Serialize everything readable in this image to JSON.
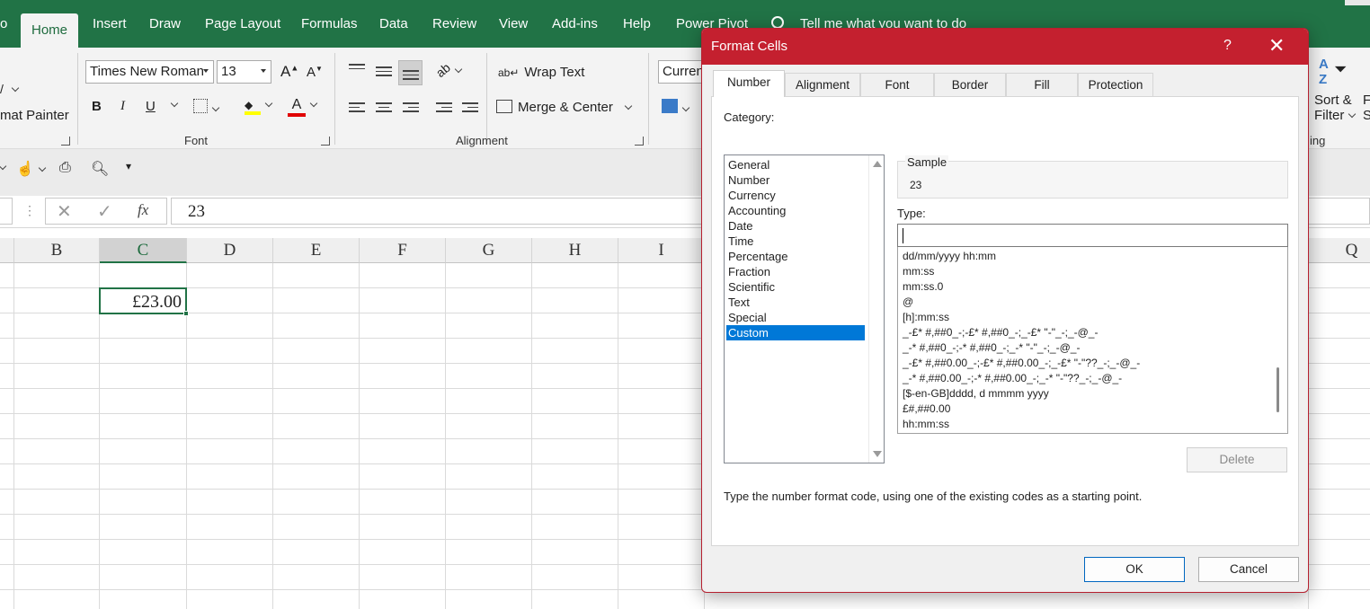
{
  "ribbon": {
    "tabs": [
      "o",
      "Home",
      "Insert",
      "Draw",
      "Page Layout",
      "Formulas",
      "Data",
      "Review",
      "View",
      "Add-ins",
      "Help",
      "Power Pivot"
    ],
    "active_tab": "Home",
    "tell_me": "Tell me what you want to do",
    "clipboard": {
      "format_painter": "mat Painter"
    },
    "font": {
      "family": "Times New Roman",
      "size": "13",
      "group_label": "Font",
      "bold": "B",
      "italic": "I",
      "underline": "U",
      "grow": "A",
      "shrink": "A"
    },
    "alignment": {
      "wrap_text": "Wrap Text",
      "merge_center": "Merge & Center",
      "group_label": "Alignment"
    },
    "number": {
      "format_box": "Currenc"
    },
    "editing": {
      "sort_filter_line1": "Sort &",
      "sort_filter_line2": "Filter",
      "find_select_line1": "F",
      "find_select_line2": "Se",
      "group_label_partial": "ing"
    }
  },
  "formula_bar": {
    "fx_label": "fx",
    "value": "23"
  },
  "grid": {
    "columns": [
      "B",
      "C",
      "D",
      "E",
      "F",
      "G",
      "H",
      "I",
      "Q"
    ],
    "selected_column": "C",
    "active_cell_value": "£23.00"
  },
  "dialog": {
    "title": "Format Cells",
    "help": "?",
    "close": "✕",
    "tabs": [
      "Number",
      "Alignment",
      "Font",
      "Border",
      "Fill",
      "Protection"
    ],
    "active_tab": "Number",
    "category_label": "Category:",
    "categories": [
      "General",
      "Number",
      "Currency",
      "Accounting",
      "Date",
      "Time",
      "Percentage",
      "Fraction",
      "Scientific",
      "Text",
      "Special",
      "Custom"
    ],
    "selected_category": "Custom",
    "sample_label": "Sample",
    "sample_value": "23",
    "type_label": "Type:",
    "type_value": "",
    "type_list": [
      "dd/mm/yyyy hh:mm",
      "mm:ss",
      "mm:ss.0",
      "@",
      "[h]:mm:ss",
      "_-£* #,##0_-;-£* #,##0_-;_-£* \"-\"_-;_-@_-",
      "_-* #,##0_-;-* #,##0_-;_-* \"-\"_-;_-@_-",
      "_-£* #,##0.00_-;-£* #,##0.00_-;_-£* \"-\"??_-;_-@_-",
      "_-* #,##0.00_-;-* #,##0.00_-;_-* \"-\"??_-;_-@_-",
      "[$-en-GB]dddd, d mmmm yyyy",
      "£#,##0.00",
      "hh:mm:ss"
    ],
    "delete_label": "Delete",
    "hint": "Type the number format code, using one of the existing codes as a starting point.",
    "ok_label": "OK",
    "cancel_label": "Cancel"
  },
  "colors": {
    "excel_green": "#217346",
    "dialog_red": "#c4202f",
    "selection_blue": "#0078d7"
  }
}
